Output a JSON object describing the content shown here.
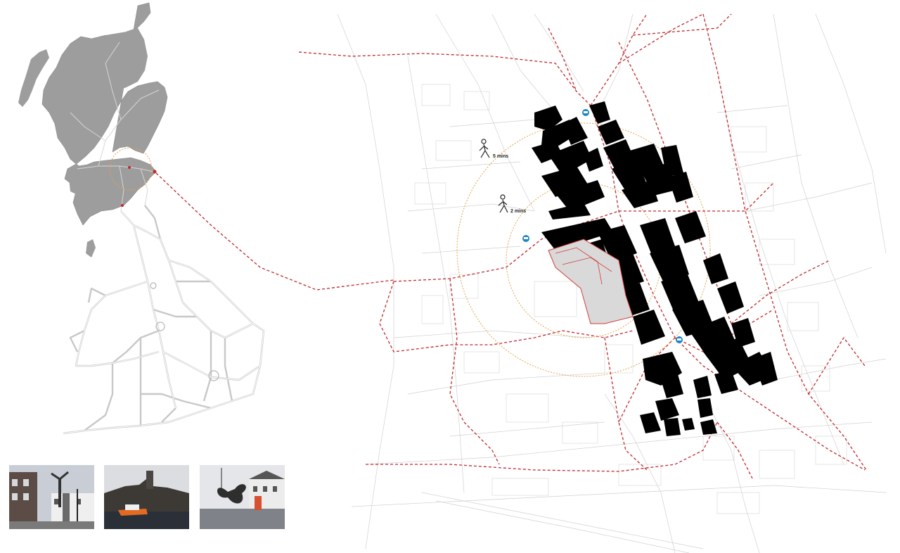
{
  "walk_times": {
    "five_min": "5 mins",
    "two_min": "2 mins"
  },
  "colors": {
    "route_red": "#c0282d",
    "walk_radius_orange": "#e3a24a",
    "building_black": "#000000",
    "uk_scotland_fill": "#9d9d9d",
    "uk_roads": "#c8c8c8",
    "bus_stop_blue": "#1d86c6",
    "site_highlight": "#d43a3a"
  },
  "icons": {
    "walker": "walking-person-icon",
    "bus_stop": "bus-stop-icon"
  },
  "photos": [
    {
      "name": "photo-street-statue"
    },
    {
      "name": "photo-castle-lifeboat"
    },
    {
      "name": "photo-propeller-sculpture"
    }
  ]
}
